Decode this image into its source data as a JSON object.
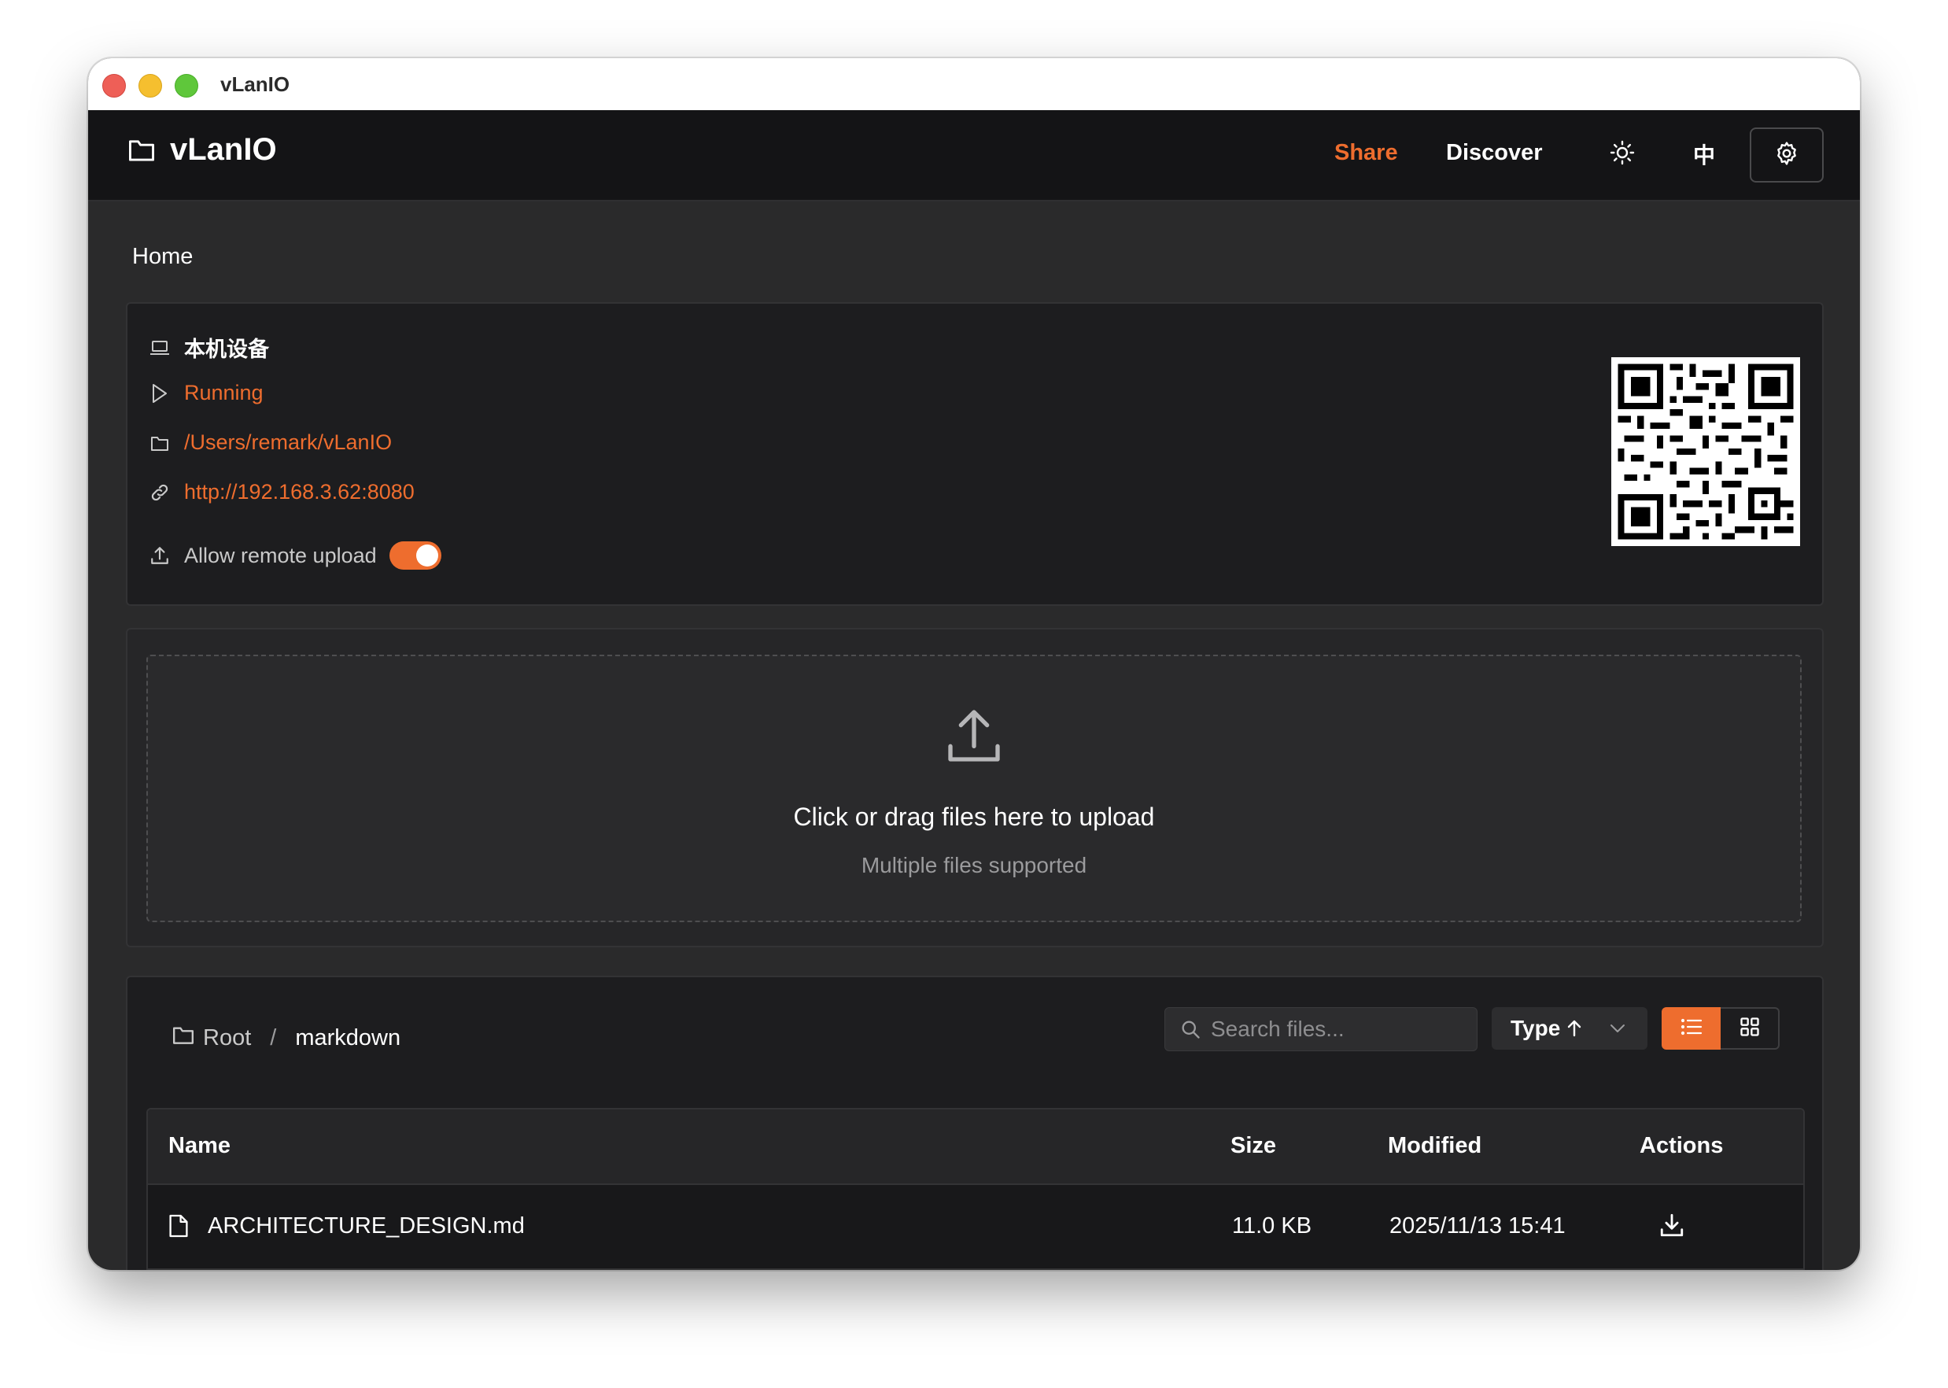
{
  "window": {
    "title": "vLanIO"
  },
  "header": {
    "brand": "vLanIO",
    "nav": {
      "share": "Share",
      "discover": "Discover"
    },
    "lang_label": "中",
    "accent": "#ee6d2e"
  },
  "breadcrumb": {
    "home": "Home"
  },
  "device": {
    "name": "本机设备",
    "status": "Running",
    "path": "/Users/remark/vLanIO",
    "url": "http://192.168.3.62:8080",
    "remote_upload_label": "Allow remote upload",
    "remote_upload_enabled": true
  },
  "upload": {
    "title": "Click or drag files here to upload",
    "subtitle": "Multiple files supported"
  },
  "files": {
    "path_root": "Root",
    "path_sep": "/",
    "path_current": "markdown",
    "search_placeholder": "Search files...",
    "sort_label": "Type",
    "view_mode": "list",
    "columns": {
      "name": "Name",
      "size": "Size",
      "modified": "Modified",
      "actions": "Actions"
    },
    "rows": [
      {
        "name": "ARCHITECTURE_DESIGN.md",
        "size": "11.0 KB",
        "modified": "2025/11/13 15:41"
      }
    ]
  }
}
